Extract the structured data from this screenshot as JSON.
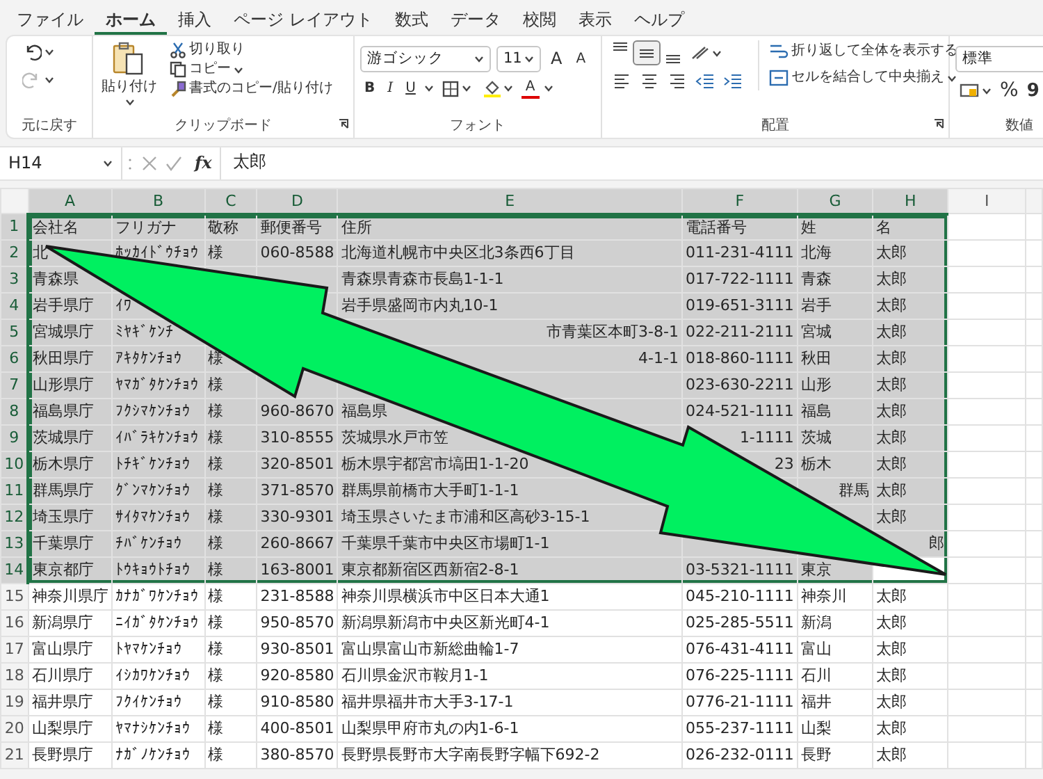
{
  "tabs": [
    {
      "label": "ファイル",
      "selected": false
    },
    {
      "label": "ホーム",
      "selected": true
    },
    {
      "label": "挿入",
      "selected": false
    },
    {
      "label": "ページ レイアウト",
      "selected": false
    },
    {
      "label": "数式",
      "selected": false
    },
    {
      "label": "データ",
      "selected": false
    },
    {
      "label": "校閲",
      "selected": false
    },
    {
      "label": "表示",
      "selected": false
    },
    {
      "label": "ヘルプ",
      "selected": false
    }
  ],
  "ribbon": {
    "undo": {
      "label": "元に戻す"
    },
    "clipboard": {
      "label": "クリップボード",
      "paste": "貼り付け",
      "cut": "切り取り",
      "copy": "コピー",
      "format_painter": "書式のコピー/貼り付け"
    },
    "font": {
      "label": "フォント",
      "font_name": "游ゴシック",
      "font_size": "11",
      "grow": "A",
      "shrink": "A",
      "bold": "B",
      "italic": "I",
      "underline": "U",
      "font_color": "A"
    },
    "alignment": {
      "label": "配置",
      "vertical": [
        {
          "selected": false
        },
        {
          "selected": true
        },
        {
          "selected": false
        }
      ],
      "wrap_text": "折り返して全体を表示する",
      "merge": "セルを結合して中央揃え"
    },
    "number": {
      "label": "数値",
      "format": "標準",
      "percent": "%",
      "comma": "9"
    }
  },
  "formula_bar": {
    "name_box": "H14",
    "function_label": "fx",
    "value": "太郎"
  },
  "sheet": {
    "columns": [
      {
        "label": "A",
        "selected": true
      },
      {
        "label": "B",
        "selected": true
      },
      {
        "label": "C",
        "selected": true
      },
      {
        "label": "D",
        "selected": true
      },
      {
        "label": "E",
        "selected": true
      },
      {
        "label": "F",
        "selected": true
      },
      {
        "label": "G",
        "selected": true
      },
      {
        "label": "H",
        "selected": true
      },
      {
        "label": "I",
        "selected": false
      }
    ],
    "rows": [
      {
        "number": "1",
        "selected": true,
        "cells": [
          "会社名",
          "フリガナ",
          "敬称",
          "郵便番号",
          "住所",
          "電話番号",
          "姓",
          "名"
        ]
      },
      {
        "number": "2",
        "selected": true,
        "cells": [
          "北",
          "ﾎｯｶｲﾄﾞｳﾁｮｳ",
          "様",
          "060-8588",
          "北海道札幌市中央区北3条西6丁目",
          "011-231-4111",
          "北海",
          "太郎"
        ]
      },
      {
        "number": "3",
        "selected": true,
        "cells": [
          "青森県",
          null,
          null,
          null,
          "青森県青森市長島1-1-1",
          "017-722-1111",
          "青森",
          "太郎"
        ]
      },
      {
        "number": "4",
        "selected": true,
        "cells": [
          "岩手県庁",
          "ｲﾜ",
          null,
          null,
          "岩手県盛岡市内丸10-1",
          "019-651-3111",
          "岩手",
          "太郎"
        ]
      },
      {
        "number": "5",
        "selected": true,
        "cells": [
          "宮城県庁",
          "ﾐﾔｷﾞｹﾝﾁ",
          null,
          null,
          {
            "text": "市青葉区本町3-8-1",
            "kind": "tail"
          },
          "022-211-2111",
          "宮城",
          "太郎"
        ]
      },
      {
        "number": "6",
        "selected": true,
        "cells": [
          "秋田県庁",
          "ｱｷﾀｹﾝﾁｮｳ",
          "様",
          null,
          {
            "text": "4-1-1",
            "kind": "tail"
          },
          "018-860-1111",
          "秋田",
          "太郎"
        ]
      },
      {
        "number": "7",
        "selected": true,
        "cells": [
          "山形県庁",
          "ﾔﾏｶﾞﾀｹﾝﾁｮｳ",
          "様",
          null,
          null,
          "023-630-2211",
          "山形",
          "太郎"
        ]
      },
      {
        "number": "8",
        "selected": true,
        "cells": [
          "福島県庁",
          "ﾌｸｼﾏｹﾝﾁｮｳ",
          "様",
          "960-8670",
          "福島県",
          "024-521-1111",
          "福島",
          "太郎"
        ]
      },
      {
        "number": "9",
        "selected": true,
        "cells": [
          "茨城県庁",
          "ｲﾊﾞﾗｷｹﾝﾁｮｳ",
          "様",
          "310-8555",
          "茨城県水戸市笠",
          {
            "text": "1-1111",
            "kind": "tail"
          },
          "茨城",
          "太郎"
        ]
      },
      {
        "number": "10",
        "selected": true,
        "cells": [
          "栃木県庁",
          "ﾄﾁｷﾞｹﾝﾁｮｳ",
          "様",
          "320-8501",
          "栃木県宇都宮市塙田1-1-20",
          {
            "text": "23",
            "kind": "tail"
          },
          "栃木",
          "太郎"
        ]
      },
      {
        "number": "11",
        "selected": true,
        "cells": [
          "群馬県庁",
          "ｸﾞﾝﾏｹﾝﾁｮｳ",
          "様",
          "371-8570",
          "群馬県前橋市大手町1-1-1",
          null,
          {
            "text": "群馬",
            "kind": "tail"
          },
          "太郎"
        ]
      },
      {
        "number": "12",
        "selected": true,
        "cells": [
          "埼玉県庁",
          "ｻｲﾀﾏｹﾝﾁｮｳ",
          "様",
          "330-9301",
          "埼玉県さいたま市浦和区高砂3-15-1",
          null,
          null,
          "太郎"
        ]
      },
      {
        "number": "13",
        "selected": true,
        "cells": [
          "千葉県庁",
          "ﾁﾊﾞｹﾝﾁｮｳ",
          "様",
          "260-8667",
          "千葉県千葉市中央区市場町1-1",
          null,
          null,
          {
            "text": "郎",
            "kind": "tail"
          }
        ]
      },
      {
        "number": "14",
        "selected": true,
        "cells": [
          "東京都庁",
          "ﾄｳｷｮｳﾄﾁｮｳ",
          "様",
          "163-8001",
          "東京都新宿区西新宿2-8-1",
          "03-5321-1111",
          "東京",
          null
        ]
      },
      {
        "number": "15",
        "selected": false,
        "cells": [
          "神奈川県庁",
          "ｶﾅｶﾞﾜｹﾝﾁｮｳ",
          "様",
          "231-8588",
          "神奈川県横浜市中区日本大通1",
          "045-210-1111",
          "神奈川",
          "太郎"
        ]
      },
      {
        "number": "16",
        "selected": false,
        "cells": [
          "新潟県庁",
          "ﾆｲｶﾞﾀｹﾝﾁｮｳ",
          "様",
          "950-8570",
          "新潟県新潟市中央区新光町4-1",
          "025-285-5511",
          "新潟",
          "太郎"
        ]
      },
      {
        "number": "17",
        "selected": false,
        "cells": [
          "富山県庁",
          "ﾄﾔﾏｹﾝﾁｮｳ",
          "様",
          "930-8501",
          "富山県富山市新総曲輪1-7",
          "076-431-4111",
          "富山",
          "太郎"
        ]
      },
      {
        "number": "18",
        "selected": false,
        "cells": [
          "石川県庁",
          "ｲｼｶﾜｹﾝﾁｮｳ",
          "様",
          "920-8580",
          "石川県金沢市鞍月1-1",
          "076-225-1111",
          "石川",
          "太郎"
        ]
      },
      {
        "number": "19",
        "selected": false,
        "cells": [
          "福井県庁",
          "ﾌｸｲｹﾝﾁｮｳ",
          "様",
          "910-8580",
          "福井県福井市大手3-17-1",
          "0776-21-1111",
          "福井",
          "太郎"
        ]
      },
      {
        "number": "20",
        "selected": false,
        "cells": [
          "山梨県庁",
          "ﾔﾏﾅｼｹﾝﾁｮｳ",
          "様",
          "400-8501",
          "山梨県甲府市丸の内1-6-1",
          "055-237-1111",
          "山梨",
          "太郎"
        ]
      },
      {
        "number": "21",
        "selected": false,
        "cells": [
          "長野県庁",
          "ﾅｶﾞﾉｹﾝﾁｮｳ",
          "様",
          "380-8570",
          "長野県長野市大字南長野字幅下692-2",
          "026-232-0111",
          "長野",
          "太郎"
        ]
      }
    ]
  }
}
